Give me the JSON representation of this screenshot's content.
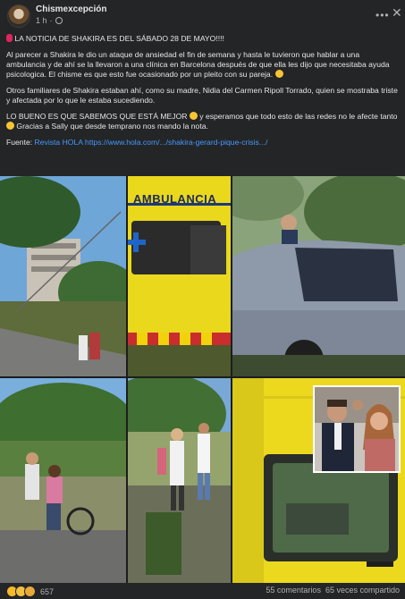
{
  "page": {
    "name": "Chismexcepción",
    "time": "1 h",
    "dot": "·"
  },
  "post": {
    "headline": "LA NOTICIA DE SHAKIRA ES DEL SÁBADO 28 DE MAYO!!!!",
    "p1": "Al parecer a Shakira le dio un ataque de ansiedad el fin de semana y hasta le tuvieron que hablar a una ambulancia y de ahí se la llevaron a una clínica en Barcelona después de que ella les dijo que necesitaba ayuda psicologica. El chisme es que esto fue ocasionado por un pleito con su pareja.",
    "p2": "Otros familiares de Shakira estaban ahí, como su madre, Nidia del Carmen Ripoll Torrado, quien se mostraba triste y afectada por lo que le estaba sucediendo.",
    "p3a": "LO BUENO ES QUE SABEMOS QUE ESTÁ MEJOR",
    "p3b": "y esperamos que todo esto de las redes no le afecte tanto",
    "p3c": "Gracias a Sally que desde temprano nos mando la nota.",
    "source_label": "Fuente:",
    "source_link1": "Revista HOLA",
    "source_link2": "https://www.hola.com/.../shakira-gerard-pique-crisis.../"
  },
  "photos": {
    "ambulance_text": "AMBULANCIA"
  },
  "footer": {
    "reaction_count": "657",
    "comments": "55 comentarios",
    "shares": "65 veces compartido"
  },
  "colors": {
    "background": "#242526",
    "text": "#e4e6eb",
    "muted": "#b0b3b8",
    "link": "#4599ff"
  },
  "icons": {
    "more": "more-options-icon",
    "close": "close-icon",
    "globe": "globe-icon"
  }
}
